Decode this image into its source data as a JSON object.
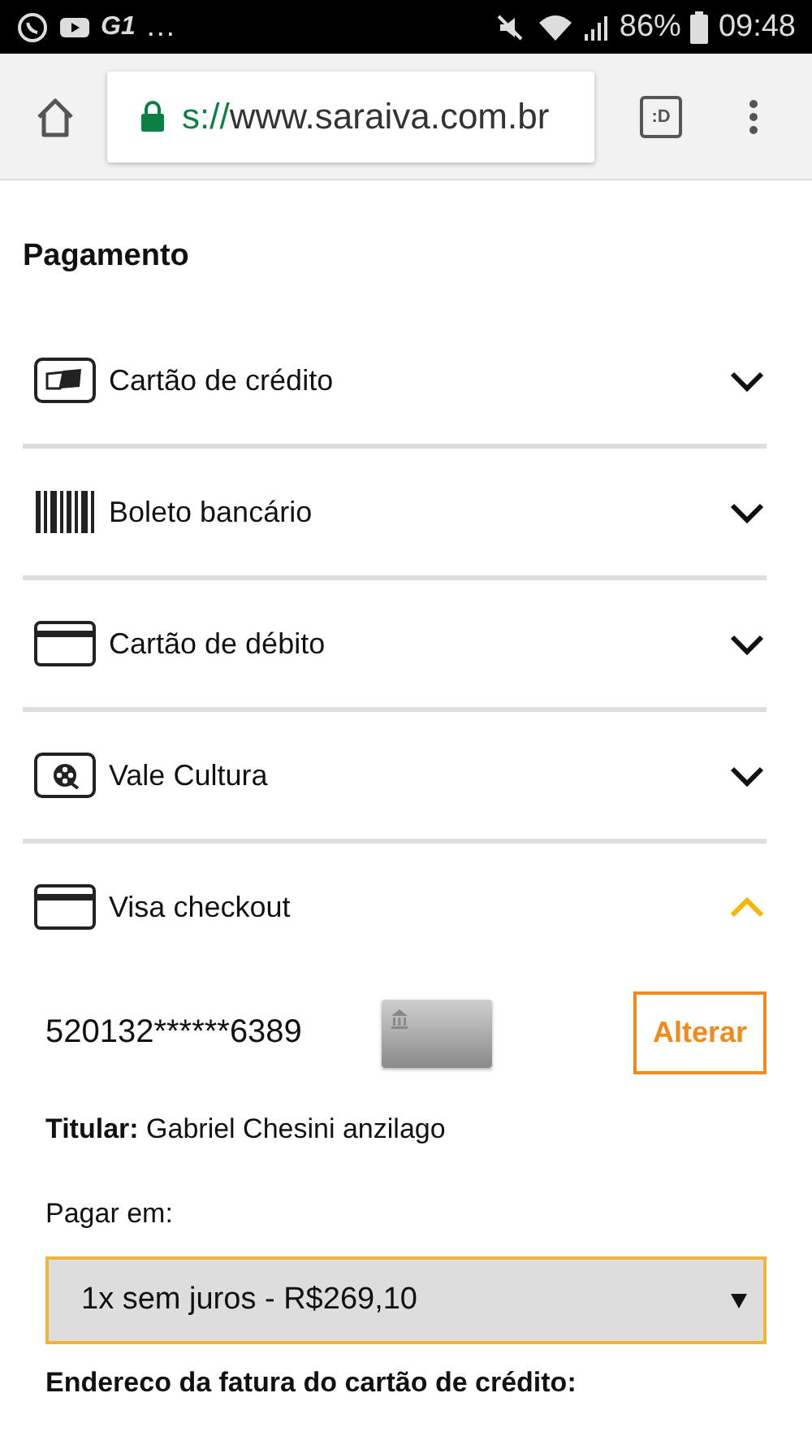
{
  "status_bar": {
    "notification_overflow": "…",
    "logo_text": "G1",
    "battery": "86%",
    "time": "09:48"
  },
  "browser": {
    "url_scheme": "s://",
    "url_host": "www.saraiva.com.br",
    "tab_switcher": ":D"
  },
  "title": "Pagamento",
  "methods": [
    {
      "label": "Cartão de crédito",
      "kind": "credit",
      "expanded": false
    },
    {
      "label": "Boleto bancário",
      "kind": "barcode",
      "expanded": false
    },
    {
      "label": "Cartão de débito",
      "kind": "card",
      "expanded": false
    },
    {
      "label": "Vale Cultura",
      "kind": "film",
      "expanded": false
    },
    {
      "label": "Visa checkout",
      "kind": "card",
      "expanded": true
    }
  ],
  "checkout": {
    "card_number": "520132******6389",
    "change_button": "Alterar",
    "holder": "**Titular:** Gabriel Chesini anzilago",
    "pay_label": "Pagar em:",
    "installments": "1x sem juros - R$269,10",
    "address_heading": "Endereco da fatura do cartão de crédito:"
  }
}
